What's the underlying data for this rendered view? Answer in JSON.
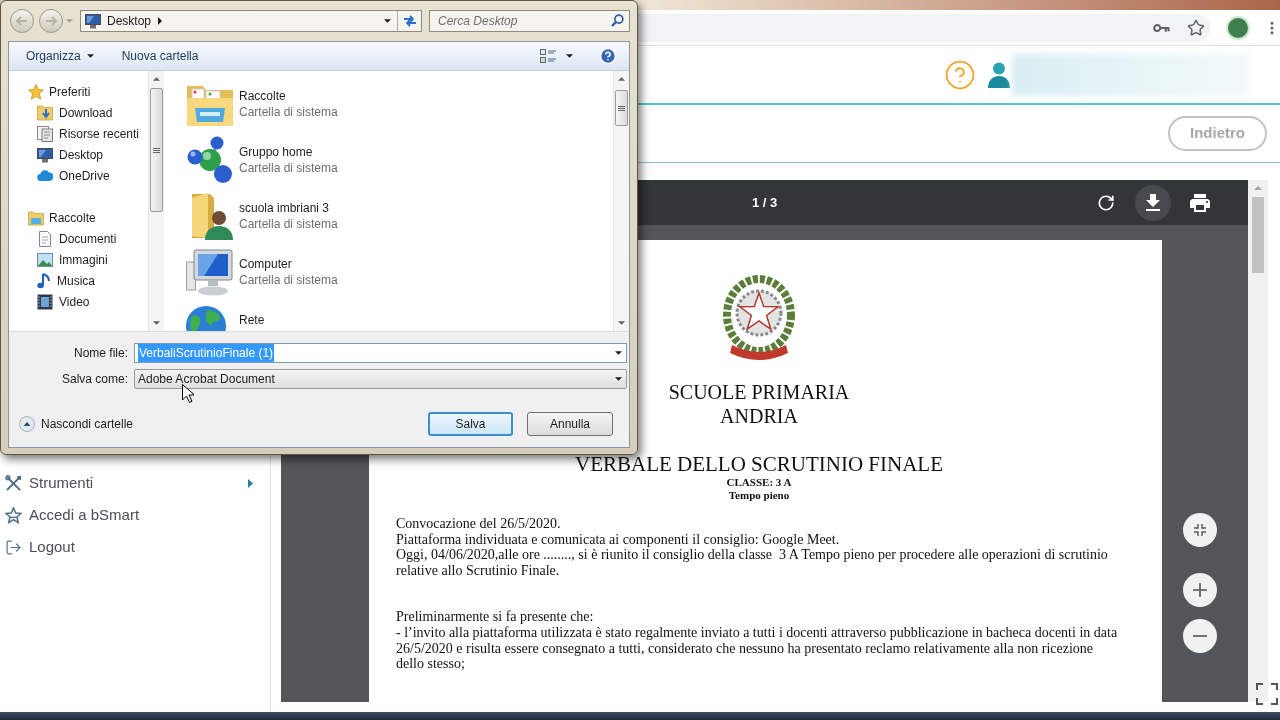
{
  "dialog": {
    "address_bar": {
      "location": "Desktop"
    },
    "search": {
      "placeholder": "Cerca Desktop"
    },
    "toolbar": [
      {
        "label": "Organizza",
        "menu": true
      },
      {
        "label": "Nuova cartella",
        "menu": false
      }
    ],
    "nav_pane": [
      {
        "label": "Preferiti",
        "children": [
          {
            "label": "Download"
          },
          {
            "label": "Risorse recenti"
          },
          {
            "label": "Desktop"
          },
          {
            "label": "OneDrive"
          }
        ]
      },
      {
        "label": "Raccolte",
        "children": [
          {
            "label": "Documenti"
          },
          {
            "label": "Immagini"
          },
          {
            "label": "Musica"
          },
          {
            "label": "Video"
          }
        ]
      }
    ],
    "files": [
      {
        "name": "Raccolte",
        "type": "Cartella di sistema"
      },
      {
        "name": "Gruppo home",
        "type": "Cartella di sistema"
      },
      {
        "name": "scuola imbriani 3",
        "type": "Cartella di sistema"
      },
      {
        "name": "Computer",
        "type": "Cartella di sistema"
      },
      {
        "name": "Rete"
      }
    ],
    "filename": {
      "label": "Nome file:",
      "value": "VerbaliScrutinioFinale (1)",
      "text_selected": true
    },
    "save_type": {
      "label": "Salva come:",
      "value": "Adobe Acrobat Document"
    },
    "hide_folders": {
      "label": "Nascondi cartelle"
    },
    "buttons": [
      {
        "label": "Salva",
        "default": true
      },
      {
        "label": "Annulla",
        "default": false
      }
    ]
  },
  "page": {
    "back_button": {
      "label": "Indietro"
    },
    "sidebar": [
      {
        "label": "Strumenti",
        "has_submenu": true
      },
      {
        "label": "Accedi a bSmart",
        "has_submenu": false
      },
      {
        "label": "Logout",
        "has_submenu": false
      }
    ],
    "pdf_viewer": {
      "page_indicator": "1 / 3",
      "tools": [
        {
          "hovered": false
        },
        {
          "hovered": true
        },
        {
          "hovered": false
        }
      ],
      "document": {
        "school": "SCUOLE PRIMARIA",
        "city": "ANDRIA",
        "title": "VERBALE DELLO SCRUTINIO FINALE",
        "class": "CLASSE: 3 A",
        "schedule": "Tempo pieno",
        "sections": [
          [
            "Convocazione del 26/5/2020.",
            "Piattaforma individuata e comunicata ai componenti il consiglio: Google Meet.",
            "Oggi, 04/06/2020,alle ore ........, si è riunito il consiglio della classe  3 A Tempo pieno per procedere alle operazioni di scrutinio relative allo Scrutinio Finale."
          ],
          [
            "Preliminarmente si fa presente che:",
            "- l’invito alla piattaforma utilizzata è stato regalmente inviato a tutti i docenti attraverso pubblicazione in bacheca docenti in data 26/5/2020 e risulta essere consegnato a tutti, considerato che nessuno ha presentato reclamo relativamente alla non ricezione dello stesso;"
          ]
        ]
      }
    }
  }
}
